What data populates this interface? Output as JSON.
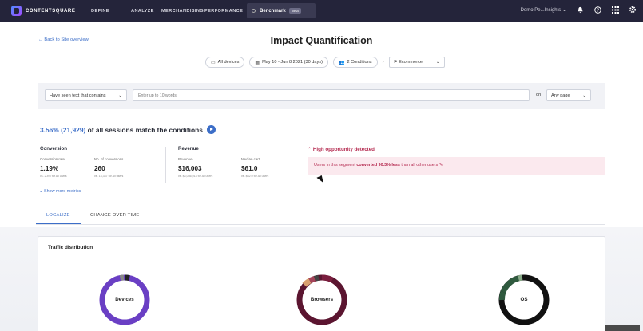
{
  "nav": {
    "brand": "CONTENTSQUARE",
    "items": [
      "DEFINE",
      "ANALYZE",
      "MERCHANDISING",
      "PERFORMANCE"
    ],
    "benchmark": "Benchmark",
    "beta": "Beta",
    "account": "Demo Pe...Insights"
  },
  "header": {
    "back": "Back to Site overview",
    "title": "Impact Quantification"
  },
  "filters": {
    "devices": "All devices",
    "dates": "May 10 - Jun 8 2021 (30 days)",
    "conditions": "2 Conditions",
    "segment": "Ecommerce"
  },
  "search": {
    "condition": "Have seen text that contains",
    "placeholder": "Enter up to 10 words",
    "on": "on",
    "page": "Any page"
  },
  "sessions": {
    "pct": "3.56% (21,929)",
    "text": "of all sessions match the conditions"
  },
  "metrics": {
    "conversion_title": "Conversion",
    "revenue_title": "Revenue",
    "items": [
      {
        "label": "Conversion rate",
        "value": "1.19%",
        "sub": "vs. 2.4% for All users"
      },
      {
        "label": "Nb. of conversions",
        "value": "260",
        "sub": "vs. 13,337 for All users"
      },
      {
        "label": "Revenue",
        "value": "$16,003",
        "sub": "vs. $4,036,013 for All users"
      },
      {
        "label": "Median cart",
        "value": "$61.0",
        "sub": "vs. $62.0 for All users"
      }
    ],
    "show_more": "Show more metrics"
  },
  "opportunity": {
    "title": "High opportunity detected",
    "text_pre": "Users in this segment",
    "text_bold": "converted 90.3% less",
    "text_post": "than all other users"
  },
  "tabs": [
    "LOCALIZE",
    "CHANGE OVER TIME"
  ],
  "traffic": {
    "title": "Traffic distribution",
    "donuts": [
      "Devices",
      "Browsers",
      "OS"
    ]
  },
  "colors": {
    "nav_bg": "#24243a",
    "accent": "#3c6ec8",
    "alert": "#b4284e",
    "devices": "#6a3fc4",
    "browsers": "#5b1530",
    "os": "#111111"
  }
}
